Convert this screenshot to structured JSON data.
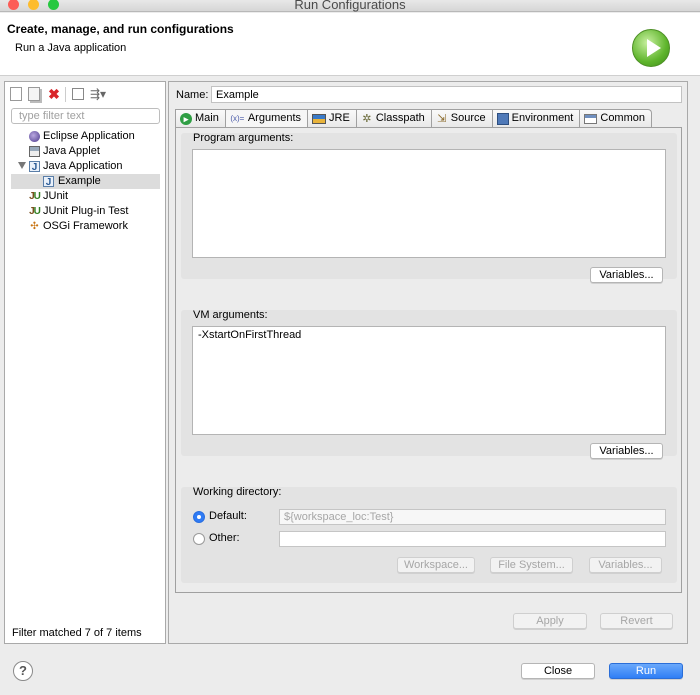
{
  "window": {
    "title": "Run Configurations"
  },
  "header": {
    "title": "Create, manage, and run configurations",
    "subtitle": "Run a Java application"
  },
  "sidebar": {
    "toolbar_icons": [
      "new-launch-config-icon",
      "duplicate-icon",
      "delete-icon",
      "collapse-all-icon",
      "filter-icon"
    ],
    "filter_placeholder": "type filter text",
    "tree": [
      {
        "label": "Eclipse Application",
        "icon": "eclipse-icon",
        "level": 0
      },
      {
        "label": "Java Applet",
        "icon": "applet-icon",
        "level": 0
      },
      {
        "label": "Java Application",
        "icon": "java-app-icon",
        "level": 0,
        "expanded": true
      },
      {
        "label": "Example",
        "icon": "java-app-icon",
        "level": 1,
        "selected": true
      },
      {
        "label": "JUnit",
        "icon": "junit-icon",
        "level": 0
      },
      {
        "label": "JUnit Plug-in Test",
        "icon": "junit-plugin-icon",
        "level": 0
      },
      {
        "label": "OSGi Framework",
        "icon": "osgi-icon",
        "level": 0
      }
    ],
    "status": "Filter matched 7 of 7 items"
  },
  "config": {
    "name_label": "Name:",
    "name_value": "Example",
    "tabs": [
      {
        "label": "Main",
        "icon": "main-icon"
      },
      {
        "label": "Arguments",
        "icon": "arguments-icon",
        "active": true
      },
      {
        "label": "JRE",
        "icon": "jre-icon"
      },
      {
        "label": "Classpath",
        "icon": "classpath-icon"
      },
      {
        "label": "Source",
        "icon": "source-icon"
      },
      {
        "label": "Environment",
        "icon": "environment-icon"
      },
      {
        "label": "Common",
        "icon": "common-icon"
      }
    ],
    "program_args": {
      "label": "Program arguments:",
      "value": "",
      "variables_label": "Variables..."
    },
    "vm_args": {
      "label": "VM arguments:",
      "value": "-XstartOnFirstThread",
      "variables_label": "Variables..."
    },
    "working_dir": {
      "label": "Working directory:",
      "default_label": "Default:",
      "default_value": "${workspace_loc:Test}",
      "other_label": "Other:",
      "other_value": "",
      "workspace_label": "Workspace...",
      "filesystem_label": "File System...",
      "variables_label": "Variables..."
    },
    "apply_label": "Apply",
    "revert_label": "Revert"
  },
  "footer": {
    "help_label": "?",
    "close_label": "Close",
    "run_label": "Run"
  },
  "colors": {
    "run_button": "#2f7ef5",
    "radio_selected": "#2f7bf5",
    "delete_icon": "#d9252a"
  }
}
